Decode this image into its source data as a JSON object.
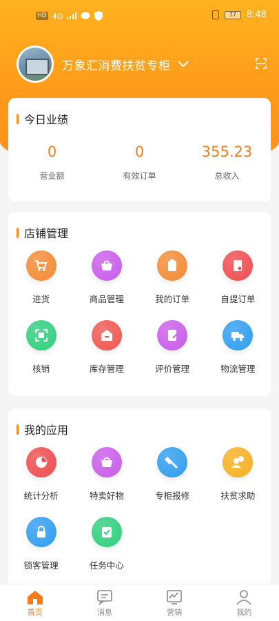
{
  "statusbar": {
    "network": "HD",
    "signal": "4G",
    "battery": "77",
    "time": "8:48"
  },
  "header": {
    "store_name": "万象汇消费扶贫专柜"
  },
  "performance": {
    "title": "今日业绩",
    "stats": [
      {
        "value": "0",
        "label": "营业额"
      },
      {
        "value": "0",
        "label": "有效订单"
      },
      {
        "value": "355.23",
        "label": "总收入"
      }
    ]
  },
  "shop_management": {
    "title": "店铺管理",
    "items": [
      {
        "label": "进货",
        "icon": "cart-icon",
        "color": "#f38a34"
      },
      {
        "label": "商品管理",
        "icon": "basket-icon",
        "color": "#c95bea"
      },
      {
        "label": "我的订单",
        "icon": "clipboard-icon",
        "color": "#f38a34"
      },
      {
        "label": "自提订单",
        "icon": "receipt-icon",
        "color": "#ee4c4f"
      },
      {
        "label": "核销",
        "icon": "scan-icon",
        "color": "#2fcf7d"
      },
      {
        "label": "库存管理",
        "icon": "inventory-icon",
        "color": "#f0564f"
      },
      {
        "label": "评价管理",
        "icon": "edit-icon",
        "color": "#c95bea"
      },
      {
        "label": "物流管理",
        "icon": "truck-icon",
        "color": "#2f9df0"
      }
    ]
  },
  "my_apps": {
    "title": "我的应用",
    "items": [
      {
        "label": "统计分析",
        "icon": "pie-chart-icon",
        "color": "#ee4c4f"
      },
      {
        "label": "特卖好物",
        "icon": "basket-icon",
        "color": "#c95bea"
      },
      {
        "label": "专柜报修",
        "icon": "wrench-icon",
        "color": "#2f9df0"
      },
      {
        "label": "扶贫求助",
        "icon": "help-user-icon",
        "color": "#f5b021"
      },
      {
        "label": "锁客管理",
        "icon": "lock-icon",
        "color": "#2f9df0"
      },
      {
        "label": "任务中心",
        "icon": "task-icon",
        "color": "#2fcf7d"
      }
    ]
  },
  "tabbar": [
    {
      "label": "首页",
      "icon": "home-icon",
      "active": true
    },
    {
      "label": "消息",
      "icon": "message-icon",
      "active": false
    },
    {
      "label": "营销",
      "icon": "marketing-chart-icon",
      "active": false
    },
    {
      "label": "我的",
      "icon": "user-icon",
      "active": false
    }
  ],
  "colors": {
    "brand": "#ff9a1a",
    "accent_text": "#f07d1a"
  }
}
